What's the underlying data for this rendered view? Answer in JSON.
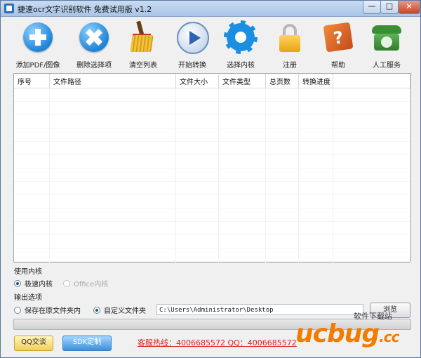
{
  "window": {
    "title": "捷速ocr文字识别软件 免费试用版 v1.2",
    "min_label": "—",
    "max_label": "□",
    "close_label": "×"
  },
  "toolbar": {
    "add": "添加PDF/图像",
    "delete": "删除选择项",
    "clear": "清空列表",
    "start": "开始转换",
    "kernel": "选择内核",
    "register": "注册",
    "help": "帮助",
    "service": "人工服务"
  },
  "table": {
    "headers": [
      "序号",
      "文件路径",
      "文件大小",
      "文件类型",
      "总页数",
      "转换进度"
    ]
  },
  "kernel": {
    "label": "使用内核",
    "fast": "极速内核",
    "office": "Office内核",
    "selected": "fast"
  },
  "output": {
    "label": "输出选项",
    "original_folder": "保存在原文件夹内",
    "custom_folder": "自定义文件夹",
    "selected": "custom",
    "path": "C:\\Users\\Administrator\\Desktop",
    "browse": "浏览"
  },
  "progress": {
    "value": 0
  },
  "footer": {
    "qq": "QQ交谈",
    "sdk": "SDK定制",
    "hotline": "客服热线：4006685572 QQ：4006685572"
  },
  "watermark": {
    "small": "软件下载站",
    "big": "ucbug",
    "suffix": ".cc"
  },
  "colors": {
    "accent": "#1d84d6",
    "hotline": "#e02020",
    "watermark": "#f07c00"
  }
}
